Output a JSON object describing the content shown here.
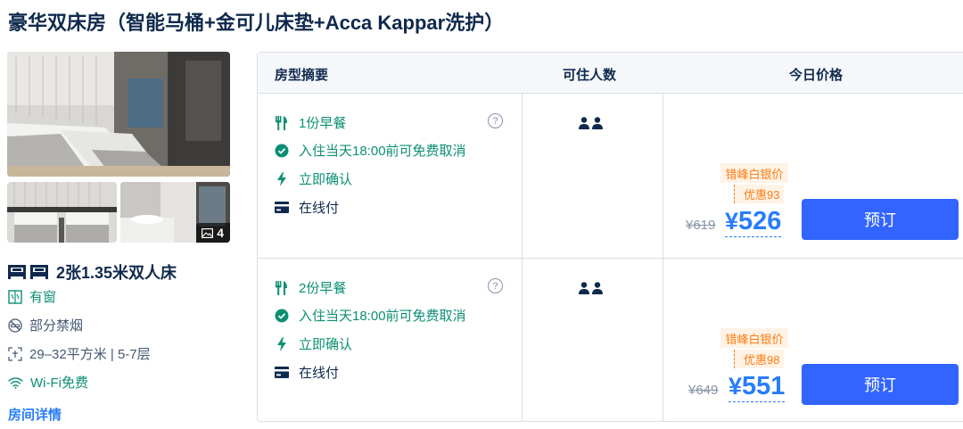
{
  "room": {
    "title": "豪华双床房（智能马桶+金可儿床垫+Acca Kappar洗护）",
    "photo_count": "4",
    "bed": "2张1.35米双人床",
    "facilities": {
      "window": "有窗",
      "smoking": "部分禁烟",
      "area": "29–32平方米 | 5-7层",
      "wifi": "Wi-Fi免费"
    },
    "detail_link": "房间详情"
  },
  "table": {
    "headers": {
      "summary": "房型摘要",
      "occupancy": "可住人数",
      "price": "今日价格"
    },
    "rows": [
      {
        "breakfast": "1份早餐",
        "cancel": "入住当天18:00前可免费取消",
        "confirm": "立即确认",
        "payment": "在线付",
        "promo_name": "错峰白银价",
        "promo_discount": "优惠93",
        "original_price": "¥619",
        "currency": "¥",
        "price": "526",
        "book_label": "预订"
      },
      {
        "breakfast": "2份早餐",
        "cancel": "入住当天18:00前可免费取消",
        "confirm": "立即确认",
        "payment": "在线付",
        "promo_name": "错峰白银价",
        "promo_discount": "优惠98",
        "original_price": "¥649",
        "currency": "¥",
        "price": "551",
        "book_label": "预订"
      }
    ]
  },
  "colors": {
    "accent_blue": "#287dfa",
    "button_blue": "#3264ff",
    "feature_green": "#0c8f73",
    "promo_orange": "#ff7d13",
    "promo_bg": "#fff2e6",
    "text_dark": "#0f294d",
    "text_grey": "#8592a6"
  },
  "icons": {
    "breakfast": "fork-knife-icon",
    "cancel": "check-circle-icon",
    "confirm": "lightning-icon",
    "payment": "card-icon",
    "help": "question-circle-icon",
    "guest": "person-icon",
    "bed": "bed-icon",
    "window": "window-icon",
    "smoking": "no-smoking-icon",
    "area": "area-icon",
    "wifi": "wifi-icon",
    "gallery": "image-icon"
  }
}
